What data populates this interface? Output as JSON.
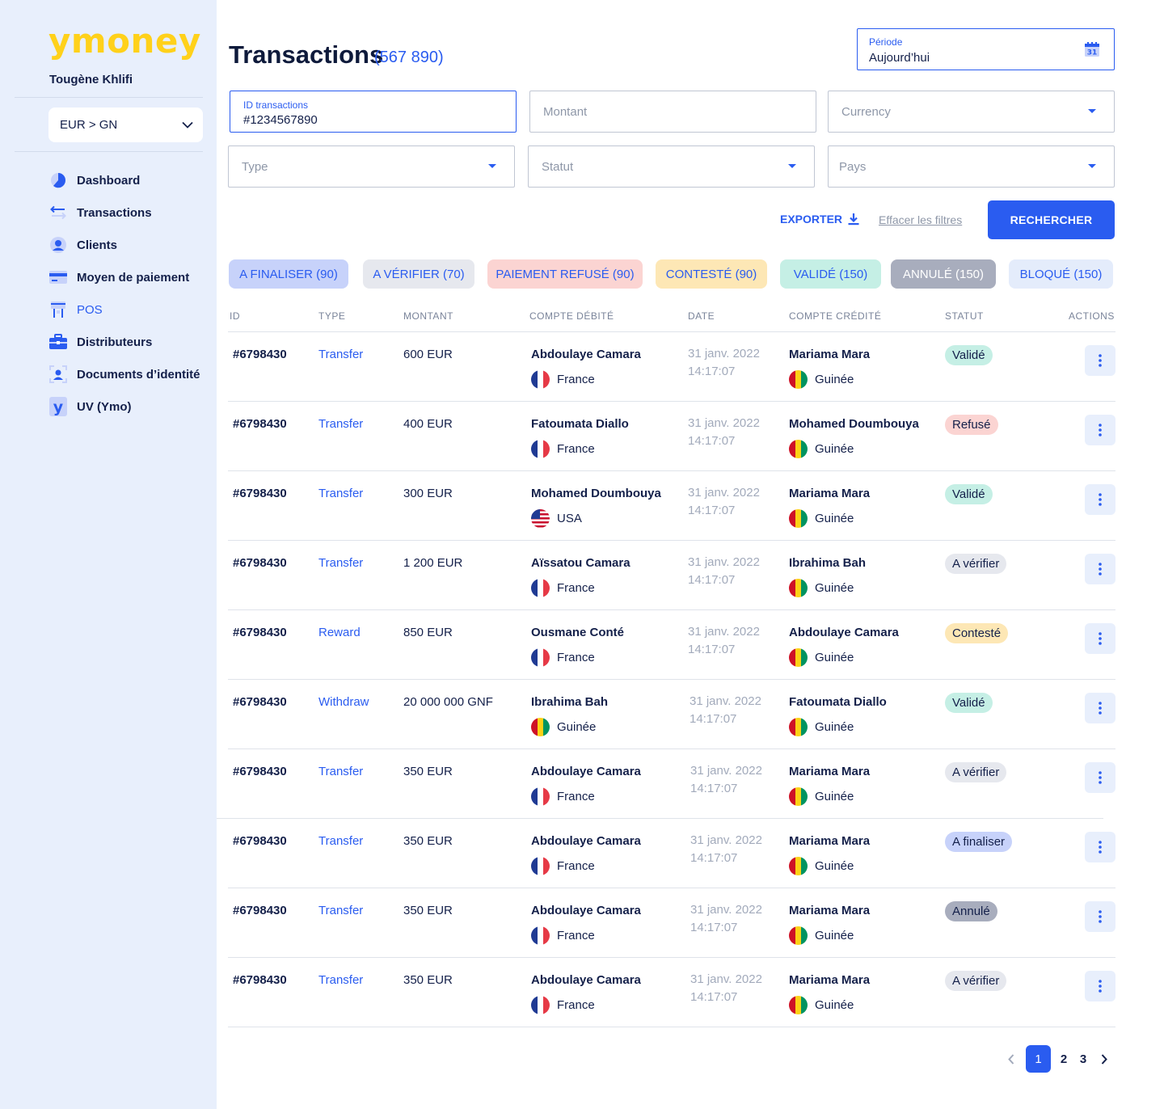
{
  "sidebar": {
    "logo": "ymoney",
    "user": "Tougène Khlifi",
    "currency": "EUR > GN",
    "nav": [
      {
        "label": "Dashboard",
        "icon": "pie-chart-icon"
      },
      {
        "label": "Transactions",
        "icon": "transfer-arrows-icon"
      },
      {
        "label": "Clients",
        "icon": "user-icon"
      },
      {
        "label": "Moyen de paiement",
        "icon": "credit-card-icon"
      },
      {
        "label": "POS",
        "icon": "pos-terminal-icon",
        "active": true
      },
      {
        "label": "Distributeurs",
        "icon": "briefcase-icon"
      },
      {
        "label": "Documents d’identité",
        "icon": "id-scan-icon"
      },
      {
        "label": "UV (Ymo)",
        "icon": "y-logo-icon"
      }
    ]
  },
  "header": {
    "title": "Transactions",
    "count": "(567 890)",
    "period_label": "Période",
    "period_value": "Aujourd’hui",
    "calendar_day": "31"
  },
  "filters": {
    "id_label": "ID transactions",
    "id_value": "#1234567890",
    "amount_placeholder": "Montant",
    "currency_placeholder": "Currency",
    "type_placeholder": "Type",
    "status_placeholder": "Statut",
    "country_placeholder": "Pays"
  },
  "toolbar": {
    "export": "EXPORTER",
    "clear": "Effacer les filtres",
    "search": "RECHERCHER"
  },
  "chips": [
    {
      "label": "A FINALISER (90)",
      "bg": "#c7d2fa",
      "color": "#2a5cf0"
    },
    {
      "label": "A VÉRIFIER (70)",
      "bg": "#e6e8ee",
      "color": "#2a5cf0"
    },
    {
      "label": "PAIEMENT REFUSÉ (90)",
      "bg": "#fbd4d2",
      "color": "#2a5cf0"
    },
    {
      "label": "CONTESTÉ (90)",
      "bg": "#fde7b5",
      "color": "#2a5cf0"
    },
    {
      "label": "VALIDÉ (150)",
      "bg": "#c5efe5",
      "color": "#2a5cf0"
    },
    {
      "label": "ANNULÉ (150)",
      "bg": "#a8adbd",
      "color": "#ffffff"
    },
    {
      "label": "BLOQUÉ (150)",
      "bg": "#e4ecfb",
      "color": "#2a5cf0"
    }
  ],
  "table": {
    "headers": [
      "ID",
      "TYPE",
      "MONTANT",
      "COMPTE DÉBITÉ",
      "DATE",
      "COMPTE CRÉDITÉ",
      "STATUT",
      "ACTIONS"
    ],
    "rows": [
      {
        "id": "#6798430",
        "type": "Transfer",
        "amount": "600 EUR",
        "debit_name": "Abdoulaye Camara",
        "debit_country": "France",
        "debit_flag": "fr",
        "date": "31 janv. 2022",
        "time": "14:17:07",
        "credit_name": "Mariama Mara",
        "credit_country": "Guinée",
        "credit_flag": "gn",
        "status": "Validé",
        "status_kind": "valid"
      },
      {
        "id": "#6798430",
        "type": "Transfer",
        "amount": "400 EUR",
        "debit_name": "Fatoumata Diallo",
        "debit_country": "France",
        "debit_flag": "fr",
        "date": "31 janv. 2022",
        "time": "14:17:07",
        "credit_name": "Mohamed Doumbouya",
        "credit_country": "Guinée",
        "credit_flag": "gn",
        "status": "Refusé",
        "status_kind": "refused"
      },
      {
        "id": "#6798430",
        "type": "Transfer",
        "amount": "300 EUR",
        "debit_name": "Mohamed Doumbouya",
        "debit_country": "USA",
        "debit_flag": "us",
        "date": "31 janv. 2022",
        "time": "14:17:07",
        "credit_name": "Mariama Mara",
        "credit_country": "Guinée",
        "credit_flag": "gn",
        "status": "Validé",
        "status_kind": "valid"
      },
      {
        "id": "#6798430",
        "type": "Transfer",
        "amount": "1 200 EUR",
        "debit_name": "Aïssatou Camara",
        "debit_country": "France",
        "debit_flag": "fr",
        "date": "31 janv. 2022",
        "time": "14:17:07",
        "credit_name": "Ibrahima Bah",
        "credit_country": "Guinée",
        "credit_flag": "gn",
        "status": "A vérifier",
        "status_kind": "verify"
      },
      {
        "id": "#6798430",
        "type": "Reward",
        "amount": "850 EUR",
        "debit_name": "Ousmane Conté",
        "debit_country": "France",
        "debit_flag": "fr",
        "date": "31 janv. 2022",
        "time": "14:17:07",
        "credit_name": "Abdoulaye Camara",
        "credit_country": "Guinée",
        "credit_flag": "gn",
        "status": "Contesté",
        "status_kind": "contested"
      },
      {
        "id": "#6798430",
        "type": "Withdraw",
        "amount": "20 000 000 GNF",
        "debit_name": "Ibrahima Bah",
        "debit_country": "Guinée",
        "debit_flag": "gn",
        "date": "31 janv. 2022",
        "time": "14:17:07",
        "credit_name": "Fatoumata Diallo",
        "credit_country": "Guinée",
        "credit_flag": "gn",
        "status": "Validé",
        "status_kind": "valid"
      },
      {
        "id": "#6798430",
        "type": "Transfer",
        "amount": "350 EUR",
        "debit_name": "Abdoulaye Camara",
        "debit_country": "France",
        "debit_flag": "fr",
        "date": "31 janv. 2022",
        "time": "14:17:07",
        "credit_name": "Mariama Mara",
        "credit_country": "Guinée",
        "credit_flag": "gn",
        "status": "A vérifier",
        "status_kind": "verify"
      },
      {
        "id": "#6798430",
        "type": "Transfer",
        "amount": "350 EUR",
        "debit_name": "Abdoulaye Camara",
        "debit_country": "France",
        "debit_flag": "fr",
        "date": "31 janv. 2022",
        "time": "14:17:07",
        "credit_name": "Mariama Mara",
        "credit_country": "Guinée",
        "credit_flag": "gn",
        "status": "A finaliser",
        "status_kind": "finalize"
      },
      {
        "id": "#6798430",
        "type": "Transfer",
        "amount": "350 EUR",
        "debit_name": "Abdoulaye Camara",
        "debit_country": "France",
        "debit_flag": "fr",
        "date": "31 janv. 2022",
        "time": "14:17:07",
        "credit_name": "Mariama Mara",
        "credit_country": "Guinée",
        "credit_flag": "gn",
        "status": "Annulé",
        "status_kind": "cancelled"
      },
      {
        "id": "#6798430",
        "type": "Transfer",
        "amount": "350 EUR",
        "debit_name": "Abdoulaye Camara",
        "debit_country": "France",
        "debit_flag": "fr",
        "date": "31 janv. 2022",
        "time": "14:17:07",
        "credit_name": "Mariama Mara",
        "credit_country": "Guinée",
        "credit_flag": "gn",
        "status": "A vérifier",
        "status_kind": "verify"
      }
    ]
  },
  "status_styles": {
    "valid": {
      "bg": "#c5efe5",
      "color": "#14204a"
    },
    "refused": {
      "bg": "#fbd4d2",
      "color": "#14204a"
    },
    "verify": {
      "bg": "#e6e8ee",
      "color": "#14204a"
    },
    "contested": {
      "bg": "#fde7b5",
      "color": "#14204a"
    },
    "finalize": {
      "bg": "#c7d2fa",
      "color": "#14204a"
    },
    "cancelled": {
      "bg": "#a8adbd",
      "color": "#14204a"
    }
  },
  "pagination": {
    "pages": [
      "1",
      "2",
      "3"
    ],
    "current": "1"
  }
}
